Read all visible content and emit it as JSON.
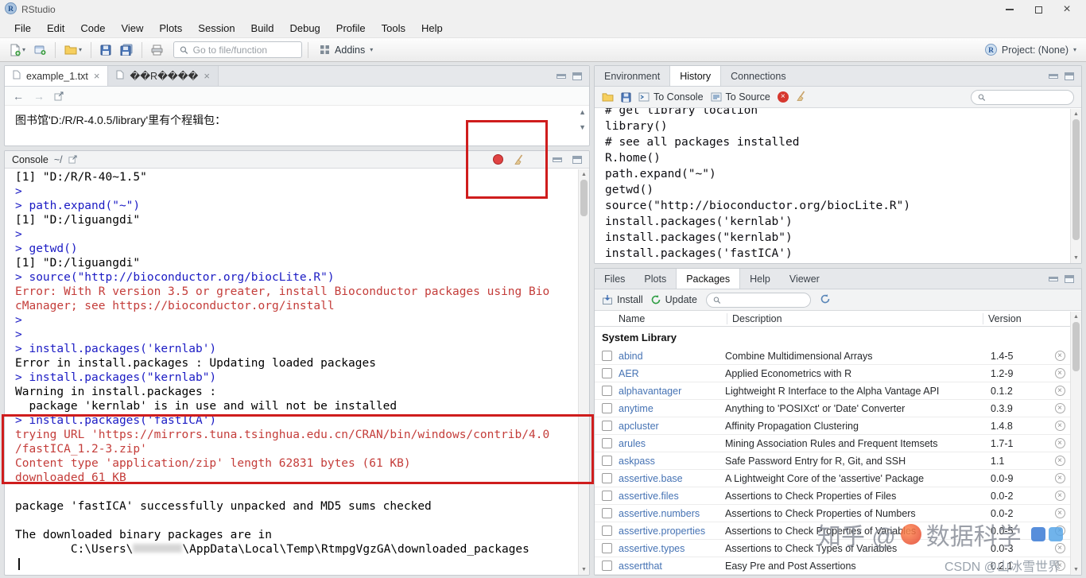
{
  "window": {
    "title": "RStudio"
  },
  "menu": {
    "items": [
      "File",
      "Edit",
      "Code",
      "View",
      "Plots",
      "Session",
      "Build",
      "Debug",
      "Profile",
      "Tools",
      "Help"
    ]
  },
  "toolbar": {
    "goto_placeholder": "Go to file/function",
    "addins_label": "Addins",
    "project_label": "Project: (None)"
  },
  "source_pane": {
    "tabs": [
      {
        "label": "example_1.txt"
      },
      {
        "label": "��R����"
      }
    ],
    "active_tab": 0,
    "content_line": "图书馆'D:/R/R-4.0.5/library'里有个程辑包："
  },
  "console_pane": {
    "title": "Console",
    "path": "~/",
    "lines": [
      {
        "type": "output",
        "text": "[1] \"D:/R/R-40~1.5\""
      },
      {
        "type": "input",
        "text": "> "
      },
      {
        "type": "input",
        "text": "> path.expand(\"~\")"
      },
      {
        "type": "output",
        "text": "[1] \"D:/liguangdi\""
      },
      {
        "type": "input",
        "text": "> "
      },
      {
        "type": "input",
        "text": "> getwd()"
      },
      {
        "type": "output",
        "text": "[1] \"D:/liguangdi\""
      },
      {
        "type": "input",
        "text": "> source(\"http://bioconductor.org/biocLite.R\")"
      },
      {
        "type": "error",
        "text": "Error: With R version 3.5 or greater, install Bioconductor packages using Bio"
      },
      {
        "type": "error",
        "text": "cManager; see https://bioconductor.org/install"
      },
      {
        "type": "input",
        "text": "> "
      },
      {
        "type": "input",
        "text": "> "
      },
      {
        "type": "input",
        "text": "> install.packages('kernlab')"
      },
      {
        "type": "output",
        "text": "Error in install.packages : Updating loaded packages"
      },
      {
        "type": "input",
        "text": "> install.packages(\"kernlab\")"
      },
      {
        "type": "output",
        "text": "Warning in install.packages :"
      },
      {
        "type": "output",
        "text": "  package 'kernlab' is in use and will not be installed"
      },
      {
        "type": "input",
        "text": "> install.packages('fastICA')"
      },
      {
        "type": "error",
        "text": "trying URL 'https://mirrors.tuna.tsinghua.edu.cn/CRAN/bin/windows/contrib/4.0"
      },
      {
        "type": "error",
        "text": "/fastICA_1.2-3.zip'"
      },
      {
        "type": "error",
        "text": "Content type 'application/zip' length 62831 bytes (61 KB)"
      },
      {
        "type": "error",
        "text": "downloaded 61 KB"
      },
      {
        "type": "output",
        "text": ""
      },
      {
        "type": "output",
        "text": "package 'fastICA' successfully unpacked and MD5 sums checked"
      },
      {
        "type": "output",
        "text": ""
      },
      {
        "type": "output",
        "text": "The downloaded binary packages are in"
      },
      {
        "type": "output",
        "text": "        C:\\Users\\",
        "redact": true,
        "rest": "\\AppData\\Local\\Temp\\RtmpgVgzGA\\downloaded_packages"
      },
      {
        "type": "cursor",
        "text": ""
      }
    ]
  },
  "history_pane": {
    "tabs": [
      "Environment",
      "History",
      "Connections"
    ],
    "active_tab": "History",
    "to_console_label": "To Console",
    "to_source_label": "To Source",
    "lines": [
      "# get library location",
      "library()",
      "# see all packages installed",
      "R.home()",
      "path.expand(\"~\")",
      "getwd()",
      "source(\"http://bioconductor.org/biocLite.R\")",
      "install.packages('kernlab')",
      "install.packages(\"kernlab\")",
      "install.packages('fastICA')"
    ]
  },
  "packages_pane": {
    "tabs": [
      "Files",
      "Plots",
      "Packages",
      "Help",
      "Viewer"
    ],
    "active_tab": "Packages",
    "install_label": "Install",
    "update_label": "Update",
    "columns": [
      "Name",
      "Description",
      "Version"
    ],
    "section_label": "System Library",
    "rows": [
      {
        "name": "abind",
        "desc": "Combine Multidimensional Arrays",
        "version": "1.4-5"
      },
      {
        "name": "AER",
        "desc": "Applied Econometrics with R",
        "version": "1.2-9"
      },
      {
        "name": "alphavantager",
        "desc": "Lightweight R Interface to the Alpha Vantage API",
        "version": "0.1.2"
      },
      {
        "name": "anytime",
        "desc": "Anything to 'POSIXct' or 'Date' Converter",
        "version": "0.3.9"
      },
      {
        "name": "apcluster",
        "desc": "Affinity Propagation Clustering",
        "version": "1.4.8"
      },
      {
        "name": "arules",
        "desc": "Mining Association Rules and Frequent Itemsets",
        "version": "1.7-1"
      },
      {
        "name": "askpass",
        "desc": "Safe Password Entry for R, Git, and SSH",
        "version": "1.1"
      },
      {
        "name": "assertive.base",
        "desc": "A Lightweight Core of the 'assertive' Package",
        "version": "0.0-9"
      },
      {
        "name": "assertive.files",
        "desc": "Assertions to Check Properties of Files",
        "version": "0.0-2"
      },
      {
        "name": "assertive.numbers",
        "desc": "Assertions to Check Properties of Numbers",
        "version": "0.0-2"
      },
      {
        "name": "assertive.properties",
        "desc": "Assertions to Check Properties of Variables",
        "version": "0.0-5"
      },
      {
        "name": "assertive.types",
        "desc": "Assertions to Check Types of Variables",
        "version": "0.0-3"
      },
      {
        "name": "assertthat",
        "desc": "Easy Pre and Post Assertions",
        "version": "0.2.1"
      }
    ]
  },
  "watermarks": {
    "zhihu_left": "知乎 @",
    "zhihu_right": "数据科学",
    "csdn": "CSDN @山冰雪世界"
  },
  "colors": {
    "console_input": "#1b1bc4",
    "console_error": "#c43d3a",
    "package_link": "#4673b4",
    "annotation": "#cf1d1d"
  }
}
